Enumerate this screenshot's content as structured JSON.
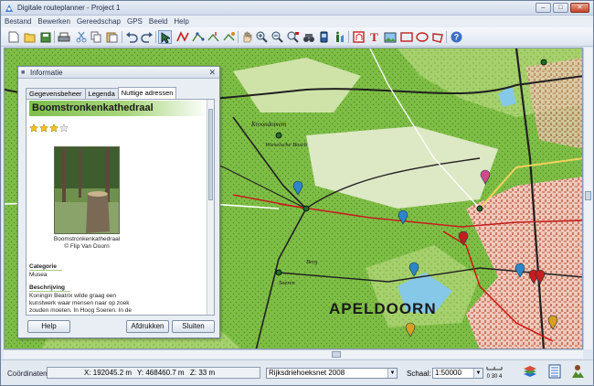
{
  "app": {
    "title": "Digitale routeplanner  - Project 1",
    "window_buttons": [
      "–",
      "□",
      "✕"
    ]
  },
  "menu": [
    "Bestand",
    "Bewerken",
    "Gereedschap",
    "GPS",
    "Beeld",
    "Help"
  ],
  "toolbar_icons": [
    "new-icon",
    "open-icon",
    "save-icon",
    "print-icon",
    "cut-icon",
    "copy-icon",
    "paste-icon",
    "undo-icon",
    "redo-icon",
    "select-arrow-icon",
    "route-icon",
    "route-edit-icon",
    "route-split-icon",
    "route-join-icon",
    "pan-hand-icon",
    "zoom-in-icon",
    "zoom-out-icon",
    "zoom-area-icon",
    "binoculars-icon",
    "gps-icon",
    "info-icon",
    "poi-icon",
    "text-icon",
    "image-icon",
    "rectangle-icon",
    "ellipse-icon",
    "polygon-icon",
    "help-icon"
  ],
  "map": {
    "city_label": "APELDOORN",
    "labels": [
      "Kroondomein",
      "Wieselsche Bosch",
      "Berg",
      "Soeren"
    ]
  },
  "info_panel": {
    "title": "Informatie",
    "tabs": [
      "Gegevensbeheer",
      "Legenda",
      "Nuttige adressen"
    ],
    "place_name": "Boomstronkenkathedraal",
    "rating": 3,
    "rating_max": 4,
    "photo_caption_1": "Boomstronkenkathedraal",
    "photo_caption_2": "© Flip Van Doorn",
    "category_label": "Categorie",
    "category_value": "Musea",
    "description_label": "Beschrijving",
    "description_lines": [
      "Koningin Beatrix wilde graag een",
      "kunstwerk waar mensen naar op zoek",
      "zouden moeten. In Hoog Soeren. In de"
    ],
    "buttons": {
      "help": "Help",
      "print": "Afdrukken",
      "close": "Sluiten"
    }
  },
  "status": {
    "coord_label": "Coördinaten:",
    "x": "X: 192045.2 m",
    "y": "Y: 468460.7 m",
    "z": "Z:   33 m",
    "map_layer": "Rijksdriehoeksnet 2008",
    "scale_label": "Schaal:",
    "scale_value": "1:50000",
    "scale_icon_text": "0 30 4"
  },
  "colors": {
    "accent_green": "#7fbf4d",
    "map_forest": "#7fbe45",
    "map_city": "#e6b7a9",
    "route_red": "#d10d0d"
  }
}
